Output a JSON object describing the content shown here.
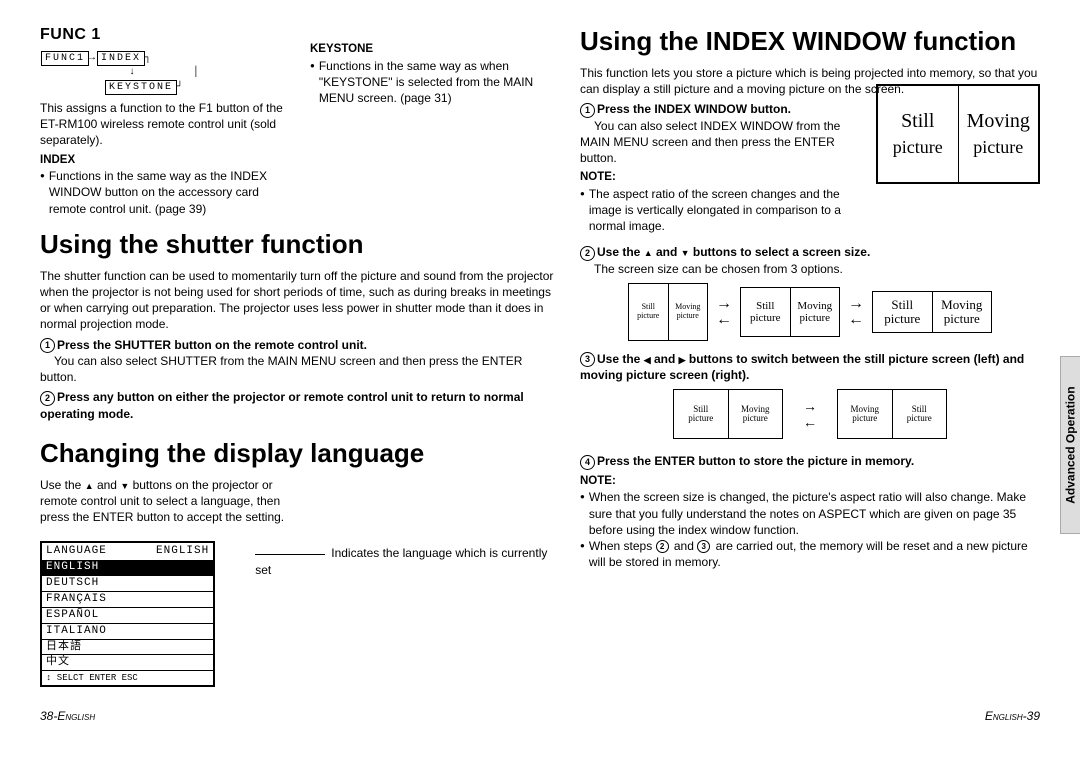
{
  "left": {
    "func": {
      "title": "FUNC 1",
      "diagram": {
        "box1": "FUNC1",
        "box2": "INDEX",
        "box3": "KEYSTONE"
      },
      "intro": "This assigns a function to the F1 button of the ET-RM100 wireless remote control unit (sold separately).",
      "index_label": "INDEX",
      "index_text": "Functions in the same way as the INDEX WINDOW button on the accessory card remote control unit. (page 39)",
      "keystone_label": "KEYSTONE",
      "keystone_text": "Functions in the same way as when \"KEYSTONE\" is selected from the MAIN MENU screen. (page 31)"
    },
    "shutter": {
      "title": "Using the shutter function",
      "intro": "The shutter function can be used to momentarily turn off the picture and sound from the projector when the projector is not being used for short periods of time, such as during breaks in meetings or when carrying out preparation. The projector uses less power in shutter mode than it does in normal projection mode.",
      "step1_bold": "Press the SHUTTER button on the remote control unit.",
      "step1_body": "You can also select SHUTTER from the MAIN MENU screen and then press the ENTER button.",
      "step2_bold": "Press any button on either the projector or remote control unit to return to normal operating mode."
    },
    "lang": {
      "title": "Changing the display language",
      "intro_a": "Use the ",
      "intro_b": " and ",
      "intro_c": " buttons on the projector or remote control unit to select a language, then press the ENTER button to accept the setting.",
      "menu_title": "LANGUAGE",
      "menu_current": "ENGLISH",
      "items": [
        "ENGLISH",
        "DEUTSCH",
        "FRANÇAIS",
        "ESPAÑOL",
        "ITALIANO",
        "日本語",
        "中文"
      ],
      "footer": "  SELCT    ENTER    ESC",
      "explain": "Indicates the language which is currently set"
    }
  },
  "right": {
    "title": "Using the INDEX WINDOW function",
    "intro": "This function lets you store a picture which is being projected into memory, so that you can display a still picture and a moving picture on the screen.",
    "step1_bold": "Press the INDEX WINDOW button.",
    "step1_body": "You can also select INDEX WINDOW from the MAIN MENU screen and then press the ENTER button.",
    "note_label": "NOTE:",
    "note1": "The aspect ratio of the screen changes and the image is vertically elongated in comparison to a normal image.",
    "still": "Still",
    "moving": "Moving",
    "picture": "picture",
    "step2_bold_a": "Use the ",
    "step2_bold_b": " and ",
    "step2_bold_c": " buttons to select a screen size.",
    "step2_body": "The screen size can be chosen from 3 options.",
    "step3_bold_a": "Use the ",
    "step3_bold_b": " and ",
    "step3_bold_c": " buttons to switch between the still picture screen (left) and moving picture screen (right).",
    "step4_bold": "Press the ENTER button to store the picture in memory.",
    "note2a": "When the screen size is changed, the picture's aspect ratio will also change. Make sure that you fully understand the notes on ASPECT which are given on page 35 before using the index window function.",
    "note2b_a": "When steps ",
    "note2b_b": " and ",
    "note2b_c": " are carried out, the memory will be reset and a new picture will be stored in memory."
  },
  "side_tab": "Advanced Operation",
  "footer_left": "38-ENGLISH",
  "footer_right": "ENGLISH-39"
}
